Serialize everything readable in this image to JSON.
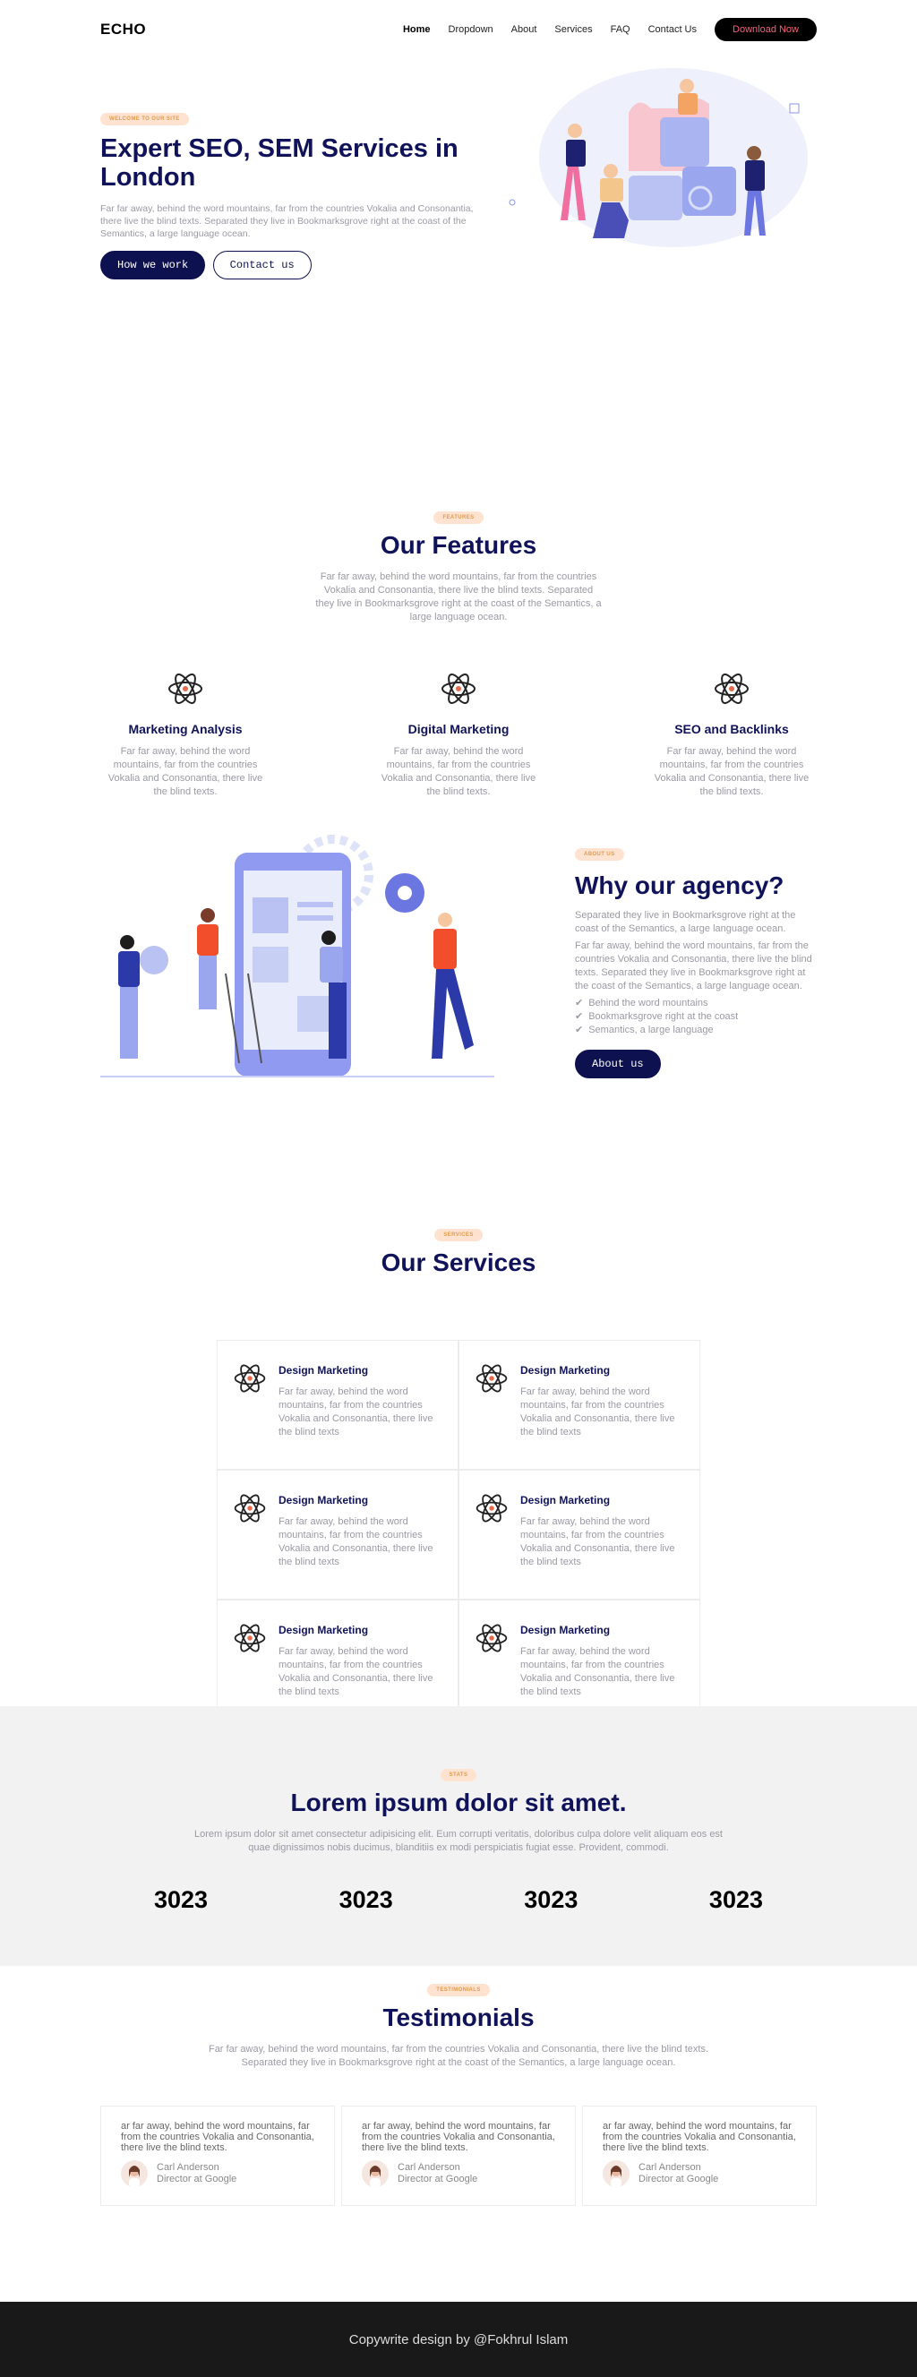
{
  "nav": {
    "logo": "ECHO",
    "items": [
      "Home",
      "Dropdown",
      "About",
      "Services",
      "FAQ",
      "Contact Us"
    ],
    "download": "Download Now"
  },
  "hero": {
    "badge": "WELCOME TO OUR SITE",
    "title": "Expert SEO, SEM Services in London",
    "text": "Far far away, behind the word mountains, far from the countries Vokalia and Consonantia, there live the blind texts. Separated they live in Bookmarksgrove right at the coast of the Semantics, a large language ocean.",
    "btn_primary": "How we work",
    "btn_secondary": "Contact us"
  },
  "features": {
    "badge": "FEATURES",
    "title": "Our Features",
    "text": "Far far away, behind the word mountains, far from the countries Vokalia and Consonantia, there live the blind texts. Separated they live in Bookmarksgrove right at the coast of the Semantics, a large language ocean.",
    "items": [
      {
        "title": "Marketing Analysis",
        "text": "Far far away, behind the word mountains, far from the countries Vokalia and Consonantia, there live the blind texts."
      },
      {
        "title": "Digital Marketing",
        "text": "Far far away, behind the word mountains, far from the countries Vokalia and Consonantia, there live the blind texts."
      },
      {
        "title": "SEO and Backlinks",
        "text": "Far far away, behind the word mountains, far from the countries Vokalia and Consonantia, there live the blind texts."
      }
    ]
  },
  "about": {
    "badge": "ABOUT US",
    "title": "Why our agency?",
    "text1": "Separated they live in Bookmarksgrove right at the coast of the Semantics, a large language ocean.",
    "text2": "Far far away, behind the word mountains, far from the countries Vokalia and Consonantia, there live the blind texts. Separated they live in Bookmarksgrove right at the coast of the Semantics, a large language ocean.",
    "checks": [
      "Behind the word mountains",
      "Bookmarksgrove right at the coast",
      "Semantics, a large language"
    ],
    "button": "About us"
  },
  "services": {
    "badge": "SERVICES",
    "title": "Our Services",
    "items": [
      {
        "title": "Design Marketing",
        "text": "Far far away, behind the word mountains, far from the countries Vokalia and Consonantia, there live the blind texts"
      },
      {
        "title": "Design Marketing",
        "text": "Far far away, behind the word mountains, far from the countries Vokalia and Consonantia, there live the blind texts"
      },
      {
        "title": "Design Marketing",
        "text": "Far far away, behind the word mountains, far from the countries Vokalia and Consonantia, there live the blind texts"
      },
      {
        "title": "Design Marketing",
        "text": "Far far away, behind the word mountains, far from the countries Vokalia and Consonantia, there live the blind texts"
      },
      {
        "title": "Design Marketing",
        "text": "Far far away, behind the word mountains, far from the countries Vokalia and Consonantia, there live the blind texts"
      },
      {
        "title": "Design Marketing",
        "text": "Far far away, behind the word mountains, far from the countries Vokalia and Consonantia, there live the blind texts"
      }
    ]
  },
  "stats": {
    "badge": "STATS",
    "title": "Lorem ipsum dolor sit amet.",
    "text": "Lorem ipsum dolor sit amet consectetur adipisicing elit. Eum corrupti veritatis, doloribus culpa dolore velit aliquam eos est quae dignissimos nobis ducimus, blanditiis ex modi perspiciatis fugiat esse. Provident, commodi.",
    "values": [
      "3023",
      "3023",
      "3023",
      "3023"
    ]
  },
  "testimonials": {
    "badge": "TESTIMONIALS",
    "title": "Testimonials",
    "text": "Far far away, behind the word mountains, far from the countries Vokalia and Consonantia, there live the blind texts. Separated they live in Bookmarksgrove right at the coast of the Semantics, a large language ocean.",
    "items": [
      {
        "quote": "ar far away, behind the word mountains, far from the countries Vokalia and Consonantia, there live the blind texts.",
        "name": "Carl Anderson",
        "role": "Director at Google"
      },
      {
        "quote": "ar far away, behind the word mountains, far from the countries Vokalia and Consonantia, there live the blind texts.",
        "name": "Carl Anderson",
        "role": "Director at Google"
      },
      {
        "quote": "ar far away, behind the word mountains, far from the countries Vokalia and Consonantia, there live the blind texts.",
        "name": "Carl Anderson",
        "role": "Director at Google"
      }
    ]
  },
  "footer": {
    "text": "Copywrite design by @Fokhrul Islam"
  },
  "colors": {
    "navy": "#10135a",
    "accent_pink": "#ff5c7a",
    "badge_bg": "#ffe3d0",
    "stats_bg": "#f2f2f2",
    "footer_bg": "#191919"
  },
  "icons": [
    "feature-atom-icon",
    "check-icon",
    "avatar"
  ]
}
